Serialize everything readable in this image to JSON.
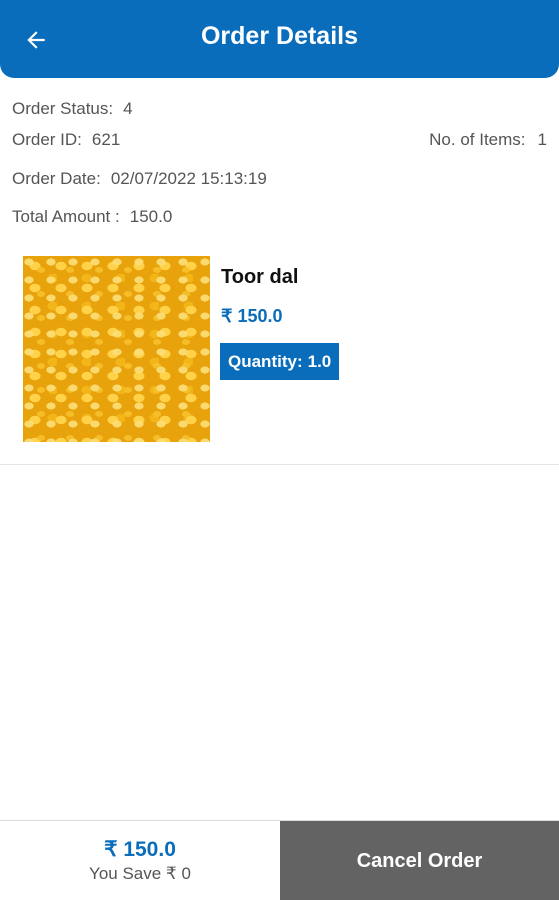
{
  "header": {
    "title": "Order Details",
    "back_icon": "arrow-left-icon"
  },
  "order": {
    "status_label": "Order Status:",
    "status_value": "4",
    "id_label": "Order ID:",
    "id_value": "621",
    "items_label": "No. of Items:",
    "items_value": "1",
    "date_label": "Order Date:",
    "date_value": "02/07/2022 15:13:19",
    "total_label": "Total Amount :",
    "total_value": "150.0"
  },
  "product": {
    "name": "Toor dal",
    "price": "₹ 150.0",
    "quantity_label": "Quantity:",
    "quantity_value": "1.0"
  },
  "footer": {
    "total_price": "₹ 150.0",
    "you_save": "You Save ₹ 0",
    "cancel_label": "Cancel Order"
  },
  "colors": {
    "primary": "#0a6dbb",
    "cancel_bg": "#636363"
  }
}
